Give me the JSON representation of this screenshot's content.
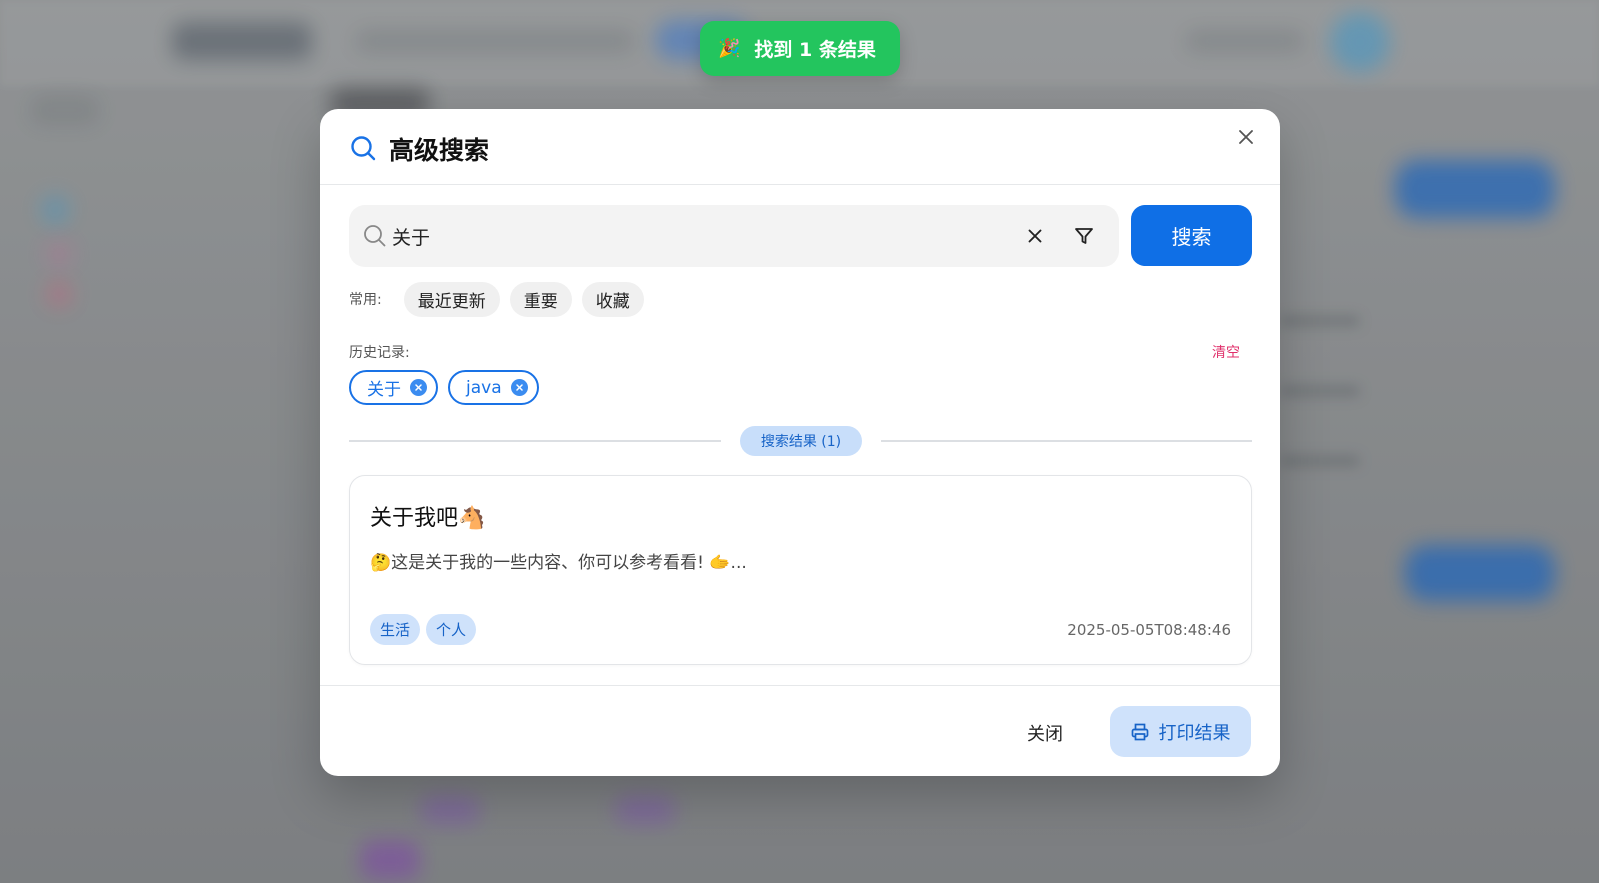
{
  "toast": {
    "icon": "party-popper-icon",
    "icon_glyph": "🎉",
    "text": "找到 1 条结果"
  },
  "modal": {
    "title": "高级搜索",
    "search": {
      "value": "关于",
      "button_label": "搜索"
    },
    "common": {
      "label": "常用:",
      "items": [
        "最近更新",
        "重要",
        "收藏"
      ]
    },
    "history": {
      "label": "历史记录:",
      "clear_label": "清空",
      "items": [
        "关于",
        "java"
      ]
    },
    "results_divider": "搜索结果 (1)",
    "results": [
      {
        "title": "关于我吧🐴",
        "excerpt": "🤔这是关于我的一些内容、你可以参考看看!  🫱...",
        "tags": [
          "生活",
          "个人"
        ],
        "date": "2025-05-05T08:48:46"
      }
    ],
    "footer": {
      "close_label": "关闭",
      "print_label": "打印结果"
    }
  },
  "colors": {
    "primary": "#0f6fe6",
    "success": "#23c55e",
    "danger": "#e0306b",
    "tag_bg": "#cfe2fb"
  }
}
